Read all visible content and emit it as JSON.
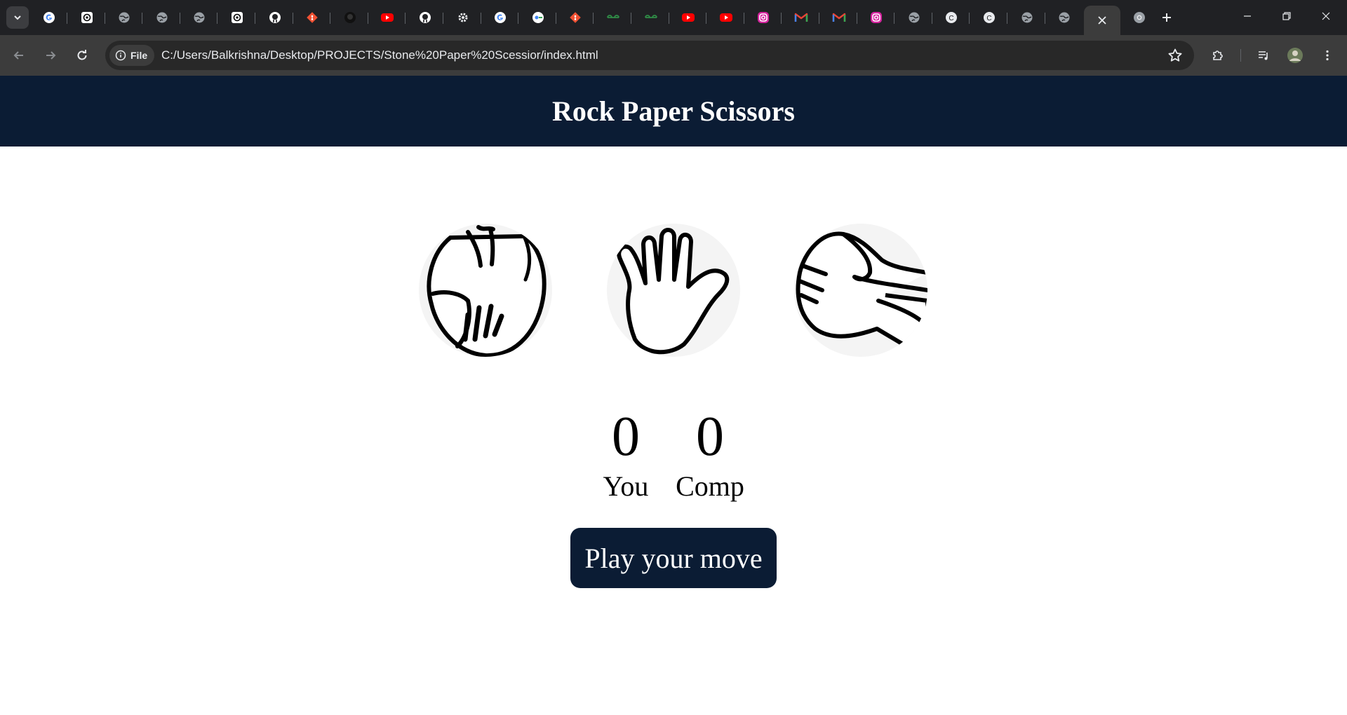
{
  "browser": {
    "tabs": [
      {
        "icon": "google-icon"
      },
      {
        "icon": "chatgpt-icon"
      },
      {
        "icon": "globe-icon"
      },
      {
        "icon": "globe-icon"
      },
      {
        "icon": "globe-icon"
      },
      {
        "icon": "chatgpt-icon"
      },
      {
        "icon": "github-icon"
      },
      {
        "icon": "git-icon"
      },
      {
        "icon": "github-dark-icon"
      },
      {
        "icon": "youtube-icon"
      },
      {
        "icon": "github-icon"
      },
      {
        "icon": "settings-icon"
      },
      {
        "icon": "google-icon"
      },
      {
        "icon": "google-lens-icon"
      },
      {
        "icon": "git-icon"
      },
      {
        "icon": "geeksforgeeks-icon"
      },
      {
        "icon": "geeksforgeeks-icon"
      },
      {
        "icon": "youtube-icon"
      },
      {
        "icon": "youtube-icon"
      },
      {
        "icon": "instagram-icon"
      },
      {
        "icon": "gmail-icon"
      },
      {
        "icon": "gmail-icon"
      },
      {
        "icon": "instagram-icon"
      },
      {
        "icon": "globe-icon"
      },
      {
        "icon": "c-letter-icon"
      },
      {
        "icon": "c-letter-icon"
      },
      {
        "icon": "globe-icon"
      },
      {
        "icon": "globe-icon"
      },
      {
        "icon": "close-icon",
        "active": true
      },
      {
        "icon": "chrome-icon"
      }
    ],
    "address": {
      "scheme_label": "File",
      "url": "C:/Users/Balkrishna/Desktop/PROJECTS/Stone%20Paper%20Scessior/index.html"
    }
  },
  "page": {
    "title": "Rock Paper Scissors",
    "choices": [
      {
        "id": "rock",
        "icon": "rock-hand-icon"
      },
      {
        "id": "paper",
        "icon": "paper-hand-icon"
      },
      {
        "id": "scissors",
        "icon": "scissors-hand-icon"
      }
    ],
    "scores": {
      "user": {
        "value": "0",
        "label": "You"
      },
      "comp": {
        "value": "0",
        "label": "Comp"
      }
    },
    "message": "Play your move"
  },
  "colors": {
    "header_bg": "#0b1c34",
    "choice_bg": "#f4f4f4",
    "browser_bg": "#202124",
    "toolbar_bg": "#3c3c3c"
  }
}
